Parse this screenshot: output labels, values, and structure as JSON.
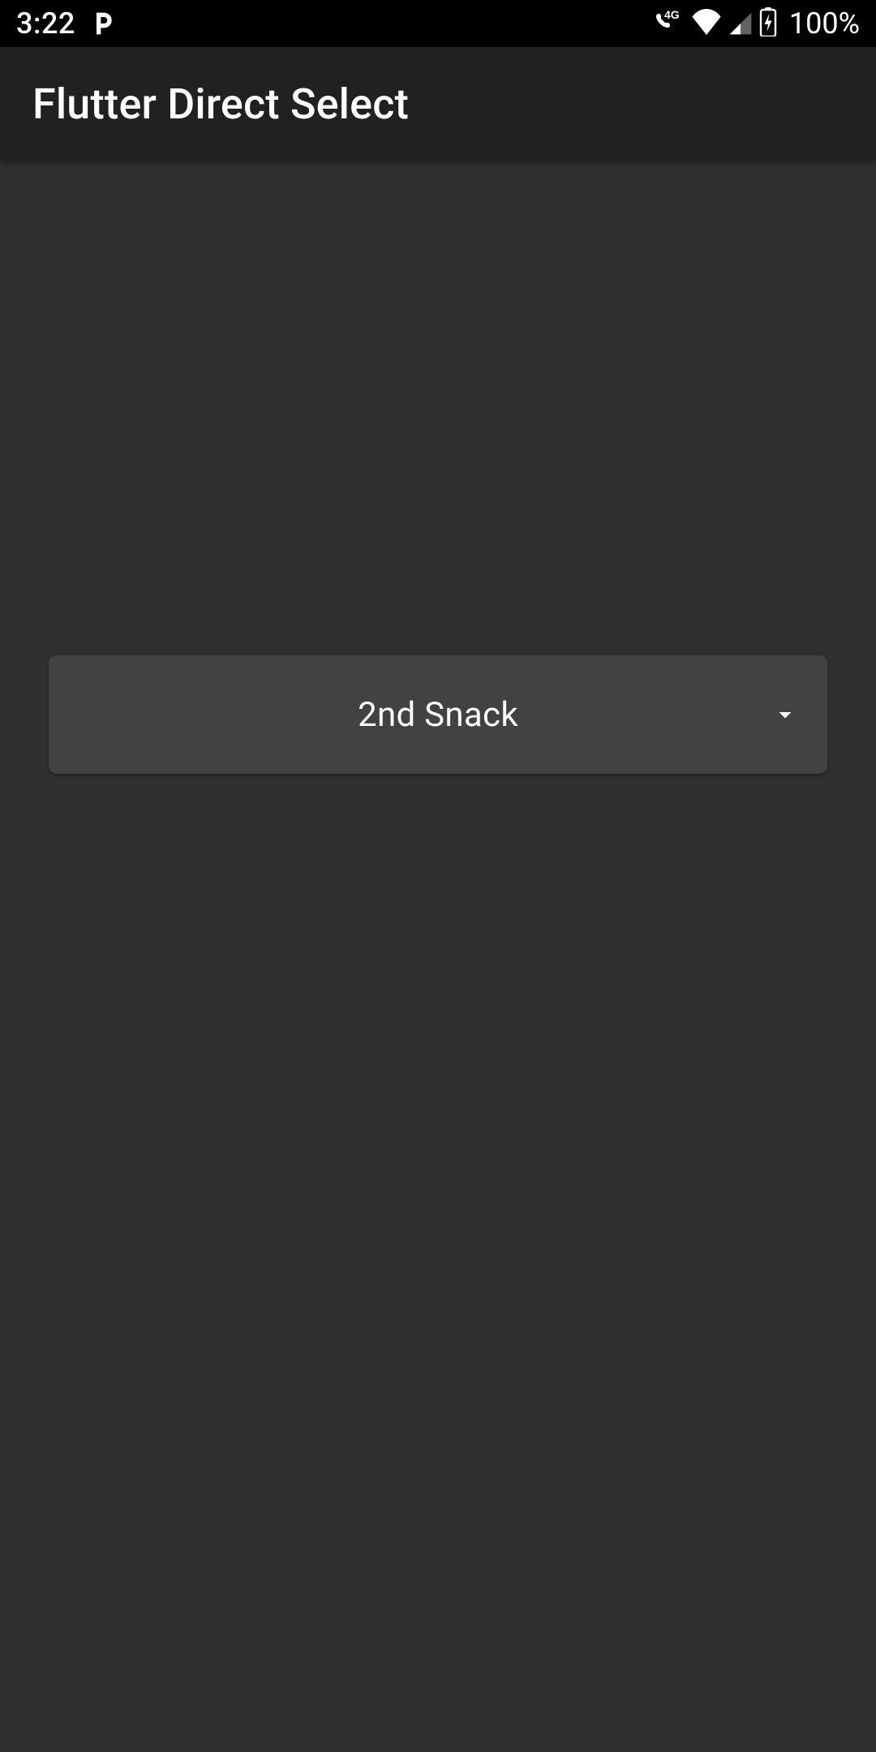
{
  "status_bar": {
    "time": "3:22",
    "battery_pct": "100%"
  },
  "app_bar": {
    "title": "Flutter Direct Select"
  },
  "select": {
    "value": "2nd Snack"
  }
}
